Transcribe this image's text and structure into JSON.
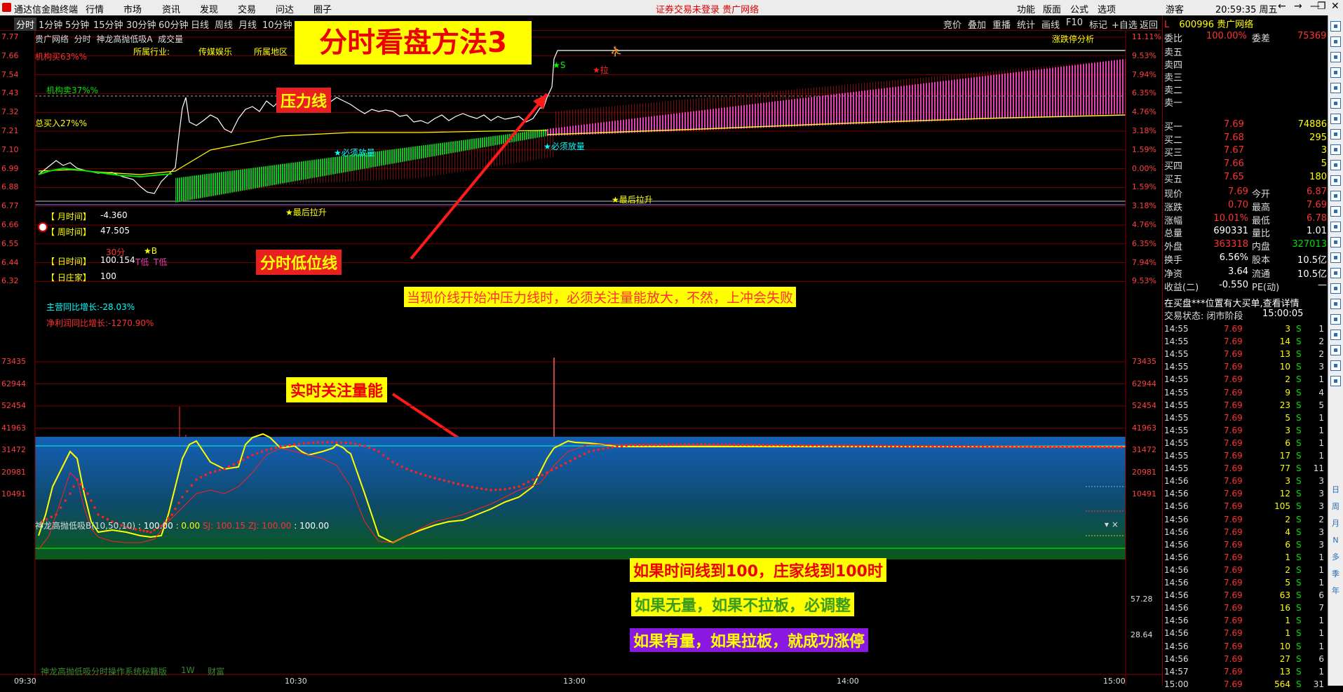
{
  "window": {
    "app_name": "通达信金融终端",
    "menu": [
      "行情",
      "市场",
      "资讯",
      "发现",
      "交易",
      "问达",
      "圈子"
    ],
    "status": "证券交易未登录  贵广网络",
    "right_menu": [
      "功能",
      "版面",
      "公式",
      "选项"
    ],
    "user": "游客",
    "clock": "20:59:35 周五",
    "controls": [
      "←",
      "→",
      "⤢",
      "—",
      "❐",
      "✕"
    ]
  },
  "toolbar": {
    "periods": [
      "分时",
      "1分钟",
      "5分钟",
      "15分钟",
      "30分钟",
      "60分钟",
      "日线",
      "周线",
      "月线",
      "10分钟"
    ],
    "right": [
      "竞价",
      "叠加",
      "重播",
      "统计",
      "画线",
      "F10",
      "标记",
      "+自选",
      "返回"
    ]
  },
  "chart_header": {
    "stock": "贵广网络",
    "mode": "分时",
    "indicator": "神龙高抛低吸A",
    "volume_label": "成交量",
    "industry_label": "所属行业:",
    "industry": "传媒娱乐",
    "region": "所属地区",
    "limit_analysis": "涨跌停分析"
  },
  "title_banner": "分时看盘方法3",
  "annotations": {
    "resistance": "压力线",
    "intraday_low": "分时低位线",
    "watch_volume": "实时关注量能",
    "yellow_note": "当现价线开始冲压力线时，必须关注量能放大，不然，上冲会失败",
    "note1": "如果时间线到100，庄家线到100时",
    "note2": "如果无量，如果不拉板，必调整",
    "note3": "如果有量，如果拉板，就成功涨停"
  },
  "overlay_text": {
    "inst_buy": "机构买63%%",
    "inst_sell": "机构卖37%%",
    "total_buy": "总买入27%%",
    "month_time_label": "【 月时间】",
    "month_time_value": "-4.360",
    "week_time_label": "【 周时间】",
    "week_time_value": "47.505",
    "day_time_label": "【 日时间】",
    "day_time_value": "100.154",
    "day_dealer_label": "【 日庄家】",
    "day_dealer_value": "100",
    "main_rev_growth": "主营同比增长:-28.03%",
    "net_profit_growth": "净利润同比增长:-1270.90%",
    "must_volume1": "★必须放量",
    "must_volume2": "★必须放量",
    "final_pull1": "★最后拉升",
    "final_pull2": "★最后拉升",
    "star_s": "★S",
    "star_la": "★拉",
    "star_b": "★B",
    "t_low": "T低",
    "t_low2": "T低",
    "min30": "30分"
  },
  "price_axis": {
    "left": [
      "7.77",
      "7.66",
      "7.54",
      "7.43",
      "7.32",
      "7.21",
      "7.10",
      "6.99",
      "6.88",
      "6.77",
      "6.66",
      "6.55",
      "6.44",
      "6.32"
    ],
    "right": [
      "11.11%",
      "9.53%",
      "7.94%",
      "6.35%",
      "4.76%",
      "3.18%",
      "1.59%",
      "0.00%",
      "1.59%",
      "3.18%",
      "4.76%",
      "6.35%",
      "7.94%",
      "9.53%"
    ]
  },
  "volume_axis": [
    "73435",
    "62944",
    "52454",
    "41963",
    "31472",
    "20981",
    "10491"
  ],
  "indicator_panel": {
    "header": "神龙高抛低吸B(10,50,10)",
    "v1": ": 100.00",
    "v2": ": 0.00",
    "sj": "SJ: 100.15",
    "zj": "ZJ: 100.00",
    "v3": ": 100.00",
    "right_values": [
      "57.28",
      "28.64"
    ],
    "footer": "神龙高抛低吸分时操作系统秘籍版",
    "footer2": "1W",
    "footer3": "财富"
  },
  "time_axis": [
    "09:30",
    "10:30",
    "13:00",
    "14:00",
    "15:00"
  ],
  "sidebar": {
    "code_prefix": "L",
    "code": "600996 贵广网络",
    "weibi_label": "委比",
    "weibi": "100.00%",
    "weicha_label": "委差",
    "weicha": "75369",
    "asks": [
      "卖五",
      "卖四",
      "卖三",
      "卖二",
      "卖一"
    ],
    "bids": [
      {
        "label": "买一",
        "price": "7.69",
        "vol": "74886"
      },
      {
        "label": "买二",
        "price": "7.68",
        "vol": "295"
      },
      {
        "label": "买三",
        "price": "7.67",
        "vol": "3"
      },
      {
        "label": "买四",
        "price": "7.66",
        "vol": "5"
      },
      {
        "label": "买五",
        "price": "7.65",
        "vol": "180"
      }
    ],
    "quote": [
      {
        "l1": "现价",
        "v1": "7.69",
        "l2": "今开",
        "v2": "6.87"
      },
      {
        "l1": "涨跌",
        "v1": "0.70",
        "l2": "最高",
        "v2": "7.69"
      },
      {
        "l1": "涨幅",
        "v1": "10.01%",
        "l2": "最低",
        "v2": "6.78"
      },
      {
        "l1": "总量",
        "v1": "690331",
        "l2": "量比",
        "v2": "1.01"
      },
      {
        "l1": "外盘",
        "v1": "363318",
        "l2": "内盘",
        "v2": "327013"
      },
      {
        "l1": "换手",
        "v1": "6.56%",
        "l2": "股本",
        "v2": "10.5亿"
      },
      {
        "l1": "净资",
        "v1": "3.64",
        "l2": "流通",
        "v2": "10.5亿"
      },
      {
        "l1": "收益(二)",
        "v1": "-0.550",
        "l2": "PE(动)",
        "v2": "—"
      }
    ],
    "notice": "在买盘***位置有大买单,查看详情",
    "trade_state_label": "交易状态: 闭市阶段",
    "trade_state_time": "15:00:05",
    "ticks": [
      [
        "14:55",
        "7.69",
        "3",
        "S",
        "1"
      ],
      [
        "14:55",
        "7.69",
        "14",
        "S",
        "2"
      ],
      [
        "14:55",
        "7.69",
        "13",
        "S",
        "2"
      ],
      [
        "14:55",
        "7.69",
        "10",
        "S",
        "3"
      ],
      [
        "14:55",
        "7.69",
        "2",
        "S",
        "1"
      ],
      [
        "14:55",
        "7.69",
        "9",
        "S",
        "4"
      ],
      [
        "14:55",
        "7.69",
        "23",
        "S",
        "5"
      ],
      [
        "14:55",
        "7.69",
        "5",
        "S",
        "1"
      ],
      [
        "14:55",
        "7.69",
        "3",
        "S",
        "1"
      ],
      [
        "14:55",
        "7.69",
        "6",
        "S",
        "1"
      ],
      [
        "14:55",
        "7.69",
        "17",
        "S",
        "1"
      ],
      [
        "14:55",
        "7.69",
        "77",
        "S",
        "11"
      ],
      [
        "14:56",
        "7.69",
        "3",
        "S",
        "3"
      ],
      [
        "14:56",
        "7.69",
        "12",
        "S",
        "3"
      ],
      [
        "14:56",
        "7.69",
        "105",
        "S",
        "3"
      ],
      [
        "14:56",
        "7.69",
        "2",
        "S",
        "2"
      ],
      [
        "14:56",
        "7.69",
        "4",
        "S",
        "3"
      ],
      [
        "14:56",
        "7.69",
        "6",
        "S",
        "3"
      ],
      [
        "14:56",
        "7.69",
        "1",
        "S",
        "1"
      ],
      [
        "14:56",
        "7.69",
        "2",
        "S",
        "1"
      ],
      [
        "14:56",
        "7.69",
        "5",
        "S",
        "1"
      ],
      [
        "14:56",
        "7.69",
        "63",
        "S",
        "6"
      ],
      [
        "14:56",
        "7.69",
        "16",
        "S",
        "7"
      ],
      [
        "14:56",
        "7.69",
        "1",
        "S",
        "1"
      ],
      [
        "14:56",
        "7.69",
        "1",
        "S",
        "1"
      ],
      [
        "14:56",
        "7.69",
        "10",
        "S",
        "1"
      ],
      [
        "14:56",
        "7.69",
        "27",
        "S",
        "6"
      ],
      [
        "14:57",
        "7.69",
        "13",
        "S",
        "1"
      ],
      [
        "15:00",
        "7.69",
        "564",
        "S",
        "31"
      ]
    ]
  },
  "right_strip": [
    "日",
    "周",
    "月",
    "N",
    "多",
    "季",
    "年"
  ],
  "colors": {
    "up": "#ff3333",
    "down": "#00e000",
    "accent": "#ffff00",
    "pink": "#e040b0"
  },
  "chart_data": {
    "type": "line",
    "x": [
      "09:30",
      "10:30",
      "13:00",
      "14:00",
      "15:00"
    ],
    "ylim": [
      6.32,
      7.77
    ],
    "prev_close": 6.99,
    "limit_up": 7.69
  }
}
